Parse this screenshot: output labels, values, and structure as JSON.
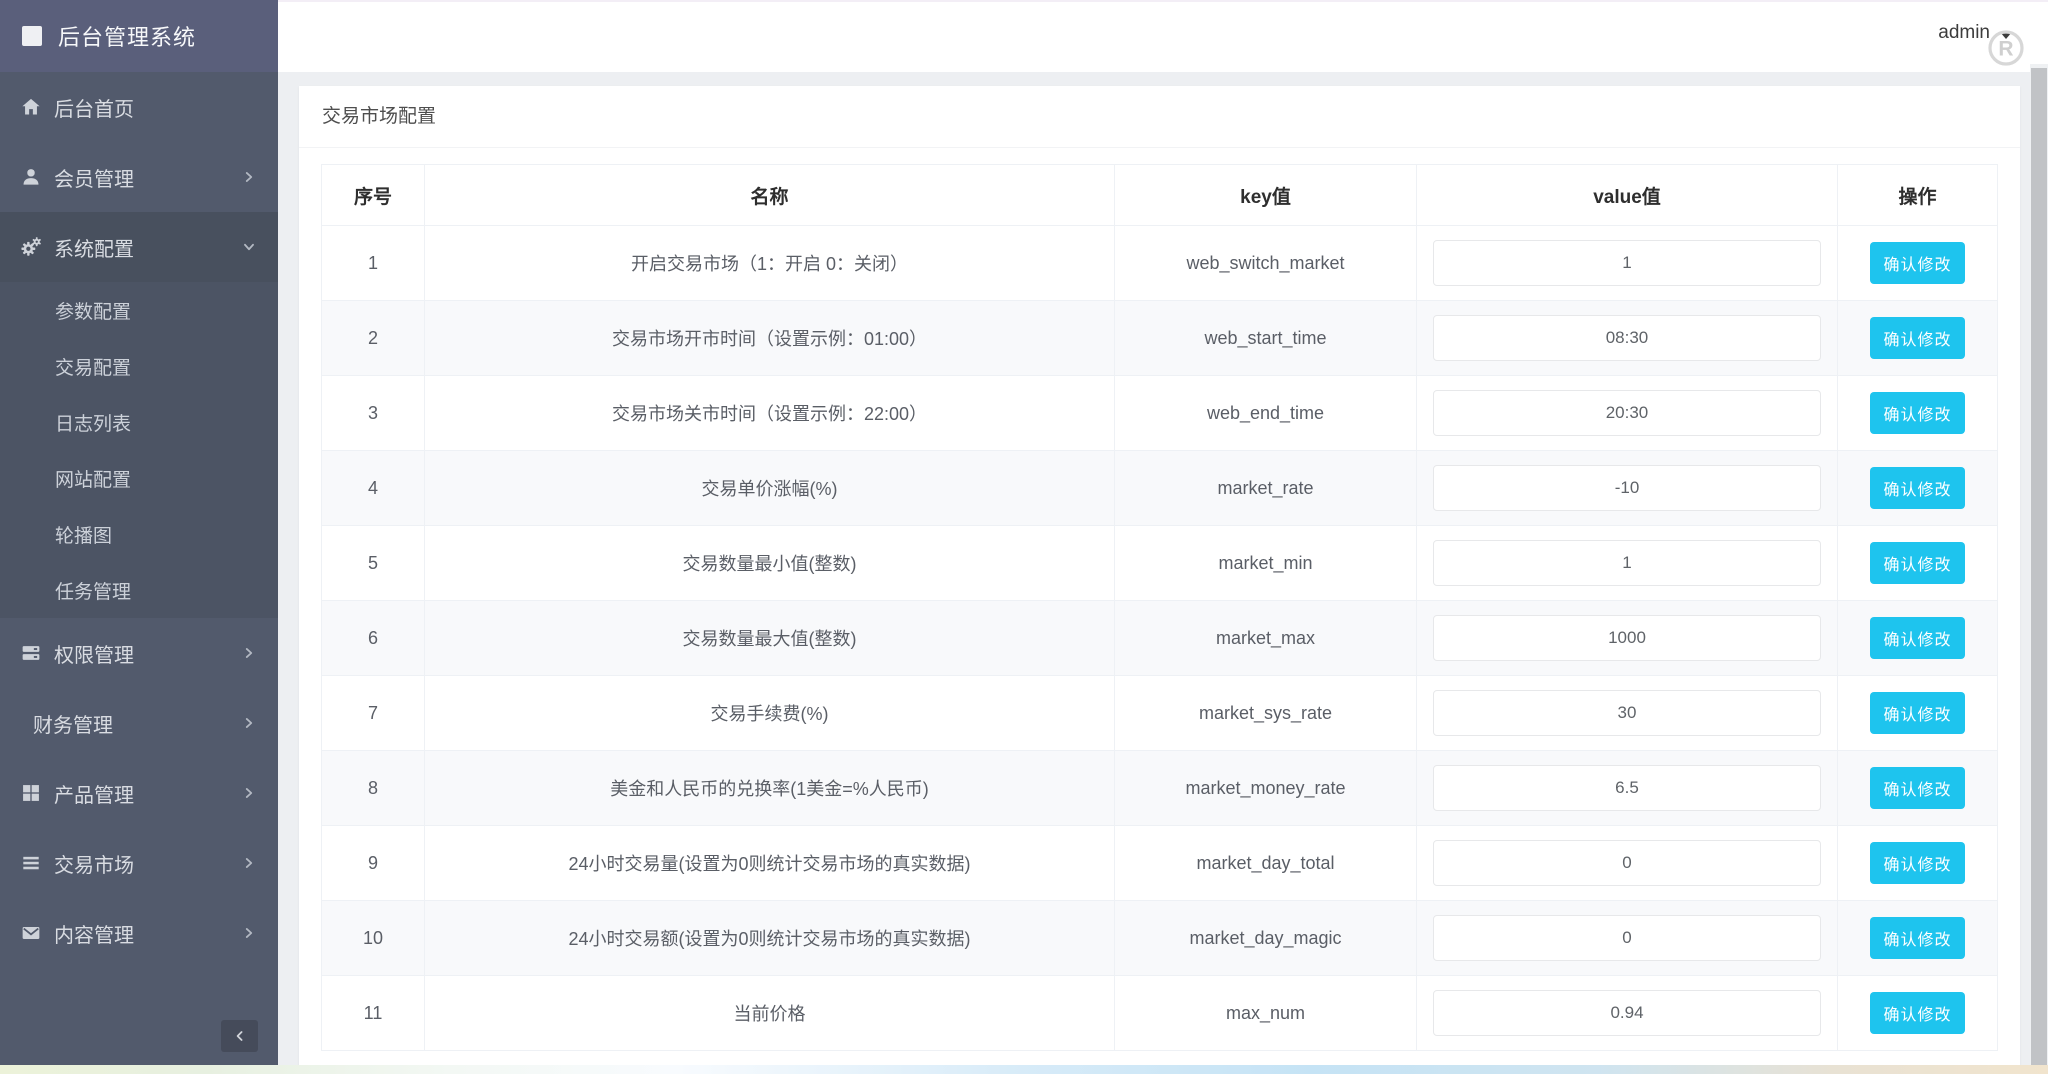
{
  "app": {
    "title": "后台管理系统"
  },
  "topbar": {
    "username": "admin"
  },
  "sidebar": {
    "items": [
      {
        "label": "后台首页"
      },
      {
        "label": "会员管理"
      },
      {
        "label": "系统配置"
      },
      {
        "label": "权限管理"
      },
      {
        "label": "财务管理"
      },
      {
        "label": "产品管理"
      },
      {
        "label": "交易市场"
      },
      {
        "label": "内容管理"
      }
    ],
    "submenu": [
      {
        "label": "参数配置"
      },
      {
        "label": "交易配置"
      },
      {
        "label": "日志列表"
      },
      {
        "label": "网站配置"
      },
      {
        "label": "轮播图"
      },
      {
        "label": "任务管理"
      }
    ]
  },
  "page": {
    "title": "交易市场配置"
  },
  "table": {
    "headers": [
      "序号",
      "名称",
      "key值",
      "value值",
      "操作"
    ],
    "confirm_label": "确认修改",
    "rows": [
      {
        "no": "1",
        "name": "开启交易市场（1：开启 0：关闭）",
        "key": "web_switch_market",
        "value": "1"
      },
      {
        "no": "2",
        "name": "交易市场开市时间（设置示例：01:00）",
        "key": "web_start_time",
        "value": "08:30"
      },
      {
        "no": "3",
        "name": "交易市场关市时间（设置示例：22:00）",
        "key": "web_end_time",
        "value": "20:30"
      },
      {
        "no": "4",
        "name": "交易单价涨幅(%)",
        "key": "market_rate",
        "value": "-10"
      },
      {
        "no": "5",
        "name": "交易数量最小值(整数)",
        "key": "market_min",
        "value": "1"
      },
      {
        "no": "6",
        "name": "交易数量最大值(整数)",
        "key": "market_max",
        "value": "1000"
      },
      {
        "no": "7",
        "name": "交易手续费(%)",
        "key": "market_sys_rate",
        "value": "30"
      },
      {
        "no": "8",
        "name": "美金和人民币的兑换率(1美金=%人民币)",
        "key": "market_money_rate",
        "value": "6.5"
      },
      {
        "no": "9",
        "name": "24小时交易量(设置为0则统计交易市场的真实数据)",
        "key": "market_day_total",
        "value": "0"
      },
      {
        "no": "10",
        "name": "24小时交易额(设置为0则统计交易市场的真实数据)",
        "key": "market_day_magic",
        "value": "0"
      },
      {
        "no": "11",
        "name": "当前价格",
        "key": "max_num",
        "value": "0.94"
      }
    ]
  },
  "colors": {
    "accent_button": "#1ec4ee",
    "sidebar_body": "#525a6c",
    "sidebar_header": "#5a5f7b",
    "sidebar_active": "#48505e",
    "content_bg": "#edeff2",
    "row_stripe": "#f8f9fb"
  }
}
